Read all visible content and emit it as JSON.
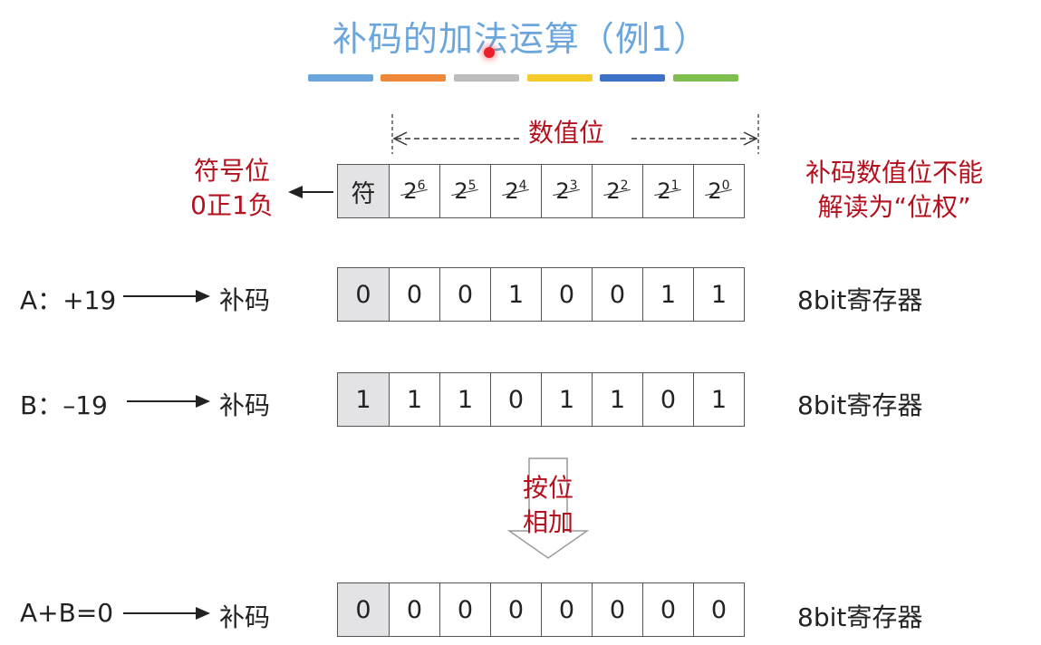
{
  "title": "补码的加法运算（例1）",
  "accent_stripes": [
    "#6aa6dc",
    "#f0883a",
    "#bdbdbd",
    "#f5cb2b",
    "#3d72c8",
    "#7ebf4f"
  ],
  "value_bits_label": "数值位",
  "sign_bit_note": {
    "line1": "符号位",
    "line2": "0正1负"
  },
  "weight_note": {
    "line1": "补码数值位不能",
    "line2": "解读为“位权”"
  },
  "header_register": {
    "sign": "符",
    "weights": [
      {
        "base": "2",
        "exp": "6"
      },
      {
        "base": "2",
        "exp": "5"
      },
      {
        "base": "2",
        "exp": "4"
      },
      {
        "base": "2",
        "exp": "3"
      },
      {
        "base": "2",
        "exp": "2"
      },
      {
        "base": "2",
        "exp": "1"
      },
      {
        "base": "2",
        "exp": "0"
      }
    ]
  },
  "rows": [
    {
      "label": "A：+19",
      "target": "补码",
      "bits": [
        "0",
        "0",
        "0",
        "1",
        "0",
        "0",
        "1",
        "1"
      ],
      "register": "8bit寄存器"
    },
    {
      "label": "B：–19",
      "target": "补码",
      "bits": [
        "1",
        "1",
        "1",
        "0",
        "1",
        "1",
        "0",
        "1"
      ],
      "register": "8bit寄存器"
    },
    {
      "label": "A+B=0",
      "target": "补码",
      "bits": [
        "0",
        "0",
        "0",
        "0",
        "0",
        "0",
        "0",
        "0"
      ],
      "register": "8bit寄存器"
    }
  ],
  "add_note": {
    "line1": "按位",
    "line2": "相加"
  }
}
